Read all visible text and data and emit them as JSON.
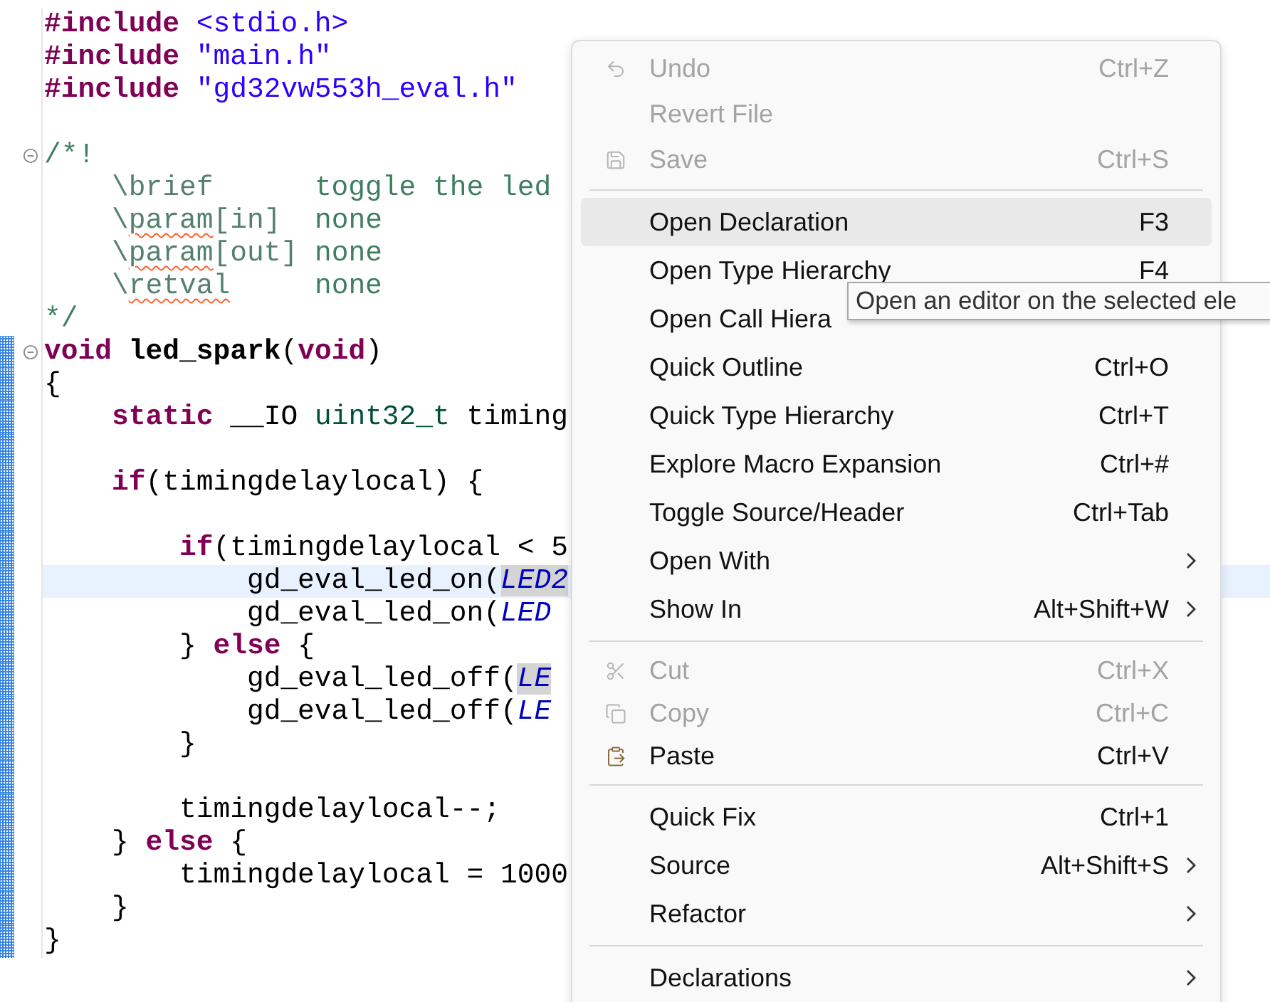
{
  "editor": {
    "lines": [
      {
        "highlighted": false,
        "tokens": [
          {
            "kind": "keyword",
            "text": "#include"
          },
          {
            "kind": "string",
            "text": " <stdio.h>"
          }
        ]
      },
      {
        "highlighted": false,
        "tokens": [
          {
            "kind": "keyword",
            "text": "#include"
          },
          {
            "kind": "string",
            "text": " \"main.h\""
          }
        ]
      },
      {
        "highlighted": false,
        "tokens": [
          {
            "kind": "keyword",
            "text": "#include"
          },
          {
            "kind": "string",
            "text": " \"gd32vw553h_eval.h\""
          }
        ]
      },
      {
        "changed": false
      },
      {
        "highlighted": false,
        "folded_start": true,
        "tokens": [
          {
            "kind": "comment",
            "text": "/*!"
          }
        ]
      },
      {
        "highlighted": false,
        "tokens": [
          {
            "kind": "doc",
            "text": "    \\brief      "
          },
          {
            "kind": "comment",
            "text": "toggle the led"
          }
        ]
      },
      {
        "highlighted": false,
        "tokens": [
          {
            "kind": "doc",
            "text": "    \\"
          },
          {
            "kind": "doc",
            "text": "param",
            "misspelled": true
          },
          {
            "kind": "doc",
            "text": "[in]  "
          },
          {
            "kind": "comment",
            "text": "none"
          }
        ]
      },
      {
        "highlighted": false,
        "tokens": [
          {
            "kind": "doc",
            "text": "    \\"
          },
          {
            "kind": "doc",
            "text": "param",
            "misspelled": true
          },
          {
            "kind": "doc",
            "text": "[out] "
          },
          {
            "kind": "comment",
            "text": "none"
          }
        ]
      },
      {
        "highlighted": false,
        "tokens": [
          {
            "kind": "doc",
            "text": "    \\"
          },
          {
            "kind": "doc",
            "text": "retval",
            "misspelled": true
          },
          {
            "kind": "comment",
            "text": "     none"
          }
        ]
      },
      {
        "highlighted": false,
        "tokens": [
          {
            "kind": "comment",
            "text": "*/"
          }
        ]
      },
      {
        "highlighted": false,
        "folded_start": true,
        "changed": true,
        "tokens": [
          {
            "kind": "keyword",
            "text": "void"
          },
          {
            "kind": "function",
            "text": " led_spark"
          },
          {
            "kind": "plain",
            "text": "("
          },
          {
            "kind": "keyword",
            "text": "void"
          },
          {
            "kind": "plain",
            "text": ")"
          }
        ]
      },
      {
        "highlighted": false,
        "changed": true,
        "tokens": [
          {
            "kind": "plain",
            "text": "{"
          }
        ]
      },
      {
        "highlighted": false,
        "changed": true,
        "tokens": [
          {
            "kind": "keyword",
            "text": "    static"
          },
          {
            "kind": "plain",
            "text": " __IO "
          },
          {
            "kind": "type",
            "text": "uint32_t"
          },
          {
            "kind": "plain",
            "text": " timing"
          }
        ]
      },
      {
        "changed": true
      },
      {
        "highlighted": false,
        "changed": true,
        "tokens": [
          {
            "kind": "keyword",
            "text": "    if"
          },
          {
            "kind": "plain",
            "text": "(timingdelaylocal) {"
          }
        ]
      },
      {
        "changed": true
      },
      {
        "highlighted": false,
        "changed": true,
        "tokens": [
          {
            "kind": "keyword",
            "text": "        if"
          },
          {
            "kind": "plain",
            "text": "(timingdelaylocal < 5"
          }
        ]
      },
      {
        "highlighted": true,
        "changed": true,
        "tokens": [
          {
            "kind": "plain",
            "text": "            gd_eval_led_on("
          },
          {
            "kind": "macro",
            "text": "LED2",
            "occurrence": true
          }
        ]
      },
      {
        "highlighted": false,
        "changed": true,
        "tokens": [
          {
            "kind": "plain",
            "text": "            gd_eval_led_on("
          },
          {
            "kind": "macro",
            "text": "LED"
          }
        ]
      },
      {
        "highlighted": false,
        "changed": true,
        "tokens": [
          {
            "kind": "plain",
            "text": "        } "
          },
          {
            "kind": "keyword",
            "text": "else"
          },
          {
            "kind": "plain",
            "text": " {"
          }
        ]
      },
      {
        "highlighted": false,
        "changed": true,
        "tokens": [
          {
            "kind": "plain",
            "text": "            gd_eval_led_off("
          },
          {
            "kind": "macro",
            "text": "LE",
            "occurrence": true
          }
        ]
      },
      {
        "highlighted": false,
        "changed": true,
        "tokens": [
          {
            "kind": "plain",
            "text": "            gd_eval_led_off("
          },
          {
            "kind": "macro",
            "text": "LE"
          }
        ]
      },
      {
        "highlighted": false,
        "changed": true,
        "tokens": [
          {
            "kind": "plain",
            "text": "        }"
          }
        ]
      },
      {
        "changed": true
      },
      {
        "highlighted": false,
        "changed": true,
        "tokens": [
          {
            "kind": "plain",
            "text": "        timingdelaylocal--;"
          }
        ]
      },
      {
        "highlighted": false,
        "changed": true,
        "tokens": [
          {
            "kind": "plain",
            "text": "    } "
          },
          {
            "kind": "keyword",
            "text": "else"
          },
          {
            "kind": "plain",
            "text": " {"
          }
        ]
      },
      {
        "highlighted": false,
        "changed": true,
        "tokens": [
          {
            "kind": "plain",
            "text": "        timingdelaylocal = 1000"
          }
        ]
      },
      {
        "highlighted": false,
        "changed": true,
        "tokens": [
          {
            "kind": "plain",
            "text": "    }"
          }
        ]
      },
      {
        "highlighted": false,
        "changed": true,
        "tokens": [
          {
            "kind": "plain",
            "text": "}"
          }
        ]
      }
    ]
  },
  "context_menu": {
    "groups": [
      {
        "items": [
          {
            "kind": "undo",
            "label": "Undo",
            "shortcut": "Ctrl+Z",
            "disabled": true,
            "selected": false
          },
          {
            "kind": "text",
            "label": "Revert File",
            "disabled": true,
            "selected": false
          },
          {
            "kind": "save",
            "label": "Save",
            "shortcut": "Ctrl+S",
            "disabled": true,
            "selected": false
          }
        ]
      },
      {
        "items": [
          {
            "kind": "text",
            "label": "Open Declaration",
            "shortcut": "F3",
            "disabled": false,
            "selected": true
          },
          {
            "kind": "text",
            "label": "Open Type Hierarchy",
            "shortcut": "F4",
            "disabled": false,
            "selected": false
          },
          {
            "kind": "text",
            "label": "Open Call Hiera",
            "disabled": false,
            "selected": false
          },
          {
            "kind": "text",
            "label": "Quick Outline",
            "shortcut": "Ctrl+O",
            "disabled": false,
            "selected": false
          },
          {
            "kind": "text",
            "label": "Quick Type Hierarchy",
            "shortcut": "Ctrl+T",
            "disabled": false,
            "selected": false
          },
          {
            "kind": "text",
            "label": "Explore Macro Expansion",
            "shortcut": "Ctrl+#",
            "disabled": false,
            "selected": false
          },
          {
            "kind": "text",
            "label": "Toggle Source/Header",
            "shortcut": "Ctrl+Tab",
            "disabled": false,
            "selected": false
          },
          {
            "kind": "text",
            "label": "Open With",
            "disabled": false,
            "selected": false,
            "submenu": true
          },
          {
            "kind": "text",
            "label": "Show In",
            "shortcut": "Alt+Shift+W",
            "disabled": false,
            "selected": false,
            "submenu": true
          }
        ]
      },
      {
        "items": [
          {
            "kind": "cut",
            "label": "Cut",
            "shortcut": "Ctrl+X",
            "disabled": true,
            "selected": false
          },
          {
            "kind": "copy",
            "label": "Copy",
            "shortcut": "Ctrl+C",
            "disabled": true,
            "selected": false
          },
          {
            "kind": "paste",
            "label": "Paste",
            "shortcut": "Ctrl+V",
            "disabled": false,
            "selected": false
          }
        ]
      },
      {
        "items": [
          {
            "kind": "text",
            "label": "Quick Fix",
            "shortcut": "Ctrl+1",
            "disabled": false,
            "selected": false
          },
          {
            "kind": "text",
            "label": "Source",
            "shortcut": "Alt+Shift+S",
            "disabled": false,
            "selected": false,
            "submenu": true
          },
          {
            "kind": "text",
            "label": "Refactor",
            "disabled": false,
            "selected": false,
            "submenu": true
          }
        ]
      },
      {
        "items": [
          {
            "kind": "text",
            "label": "Declarations",
            "disabled": false,
            "selected": false,
            "submenu": true
          }
        ]
      }
    ]
  },
  "tooltip": {
    "text": "Open an editor on the selected ele"
  }
}
